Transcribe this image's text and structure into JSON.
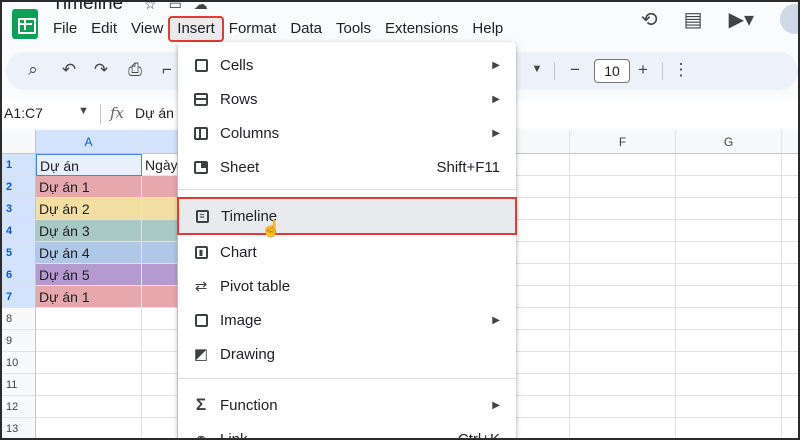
{
  "app": {
    "doc_title": "Timeline",
    "logo_icon": "sheets-logo-icon"
  },
  "menubar": {
    "items": [
      "File",
      "Edit",
      "View",
      "Insert",
      "Format",
      "Data",
      "Tools",
      "Extensions",
      "Help"
    ],
    "active": "Insert"
  },
  "toolbar": {
    "font_size": "10",
    "minus": "−",
    "plus": "+",
    "more": "⋮"
  },
  "formula_bar": {
    "name_box": "A1:C7",
    "fx": "fx",
    "value": "Dự án"
  },
  "grid": {
    "columns": [
      "A",
      "",
      "F",
      "G"
    ],
    "rows": [
      "1",
      "2",
      "3",
      "4",
      "5",
      "6",
      "7",
      "8",
      "9",
      "10",
      "11",
      "12",
      "13"
    ],
    "col_a_values": [
      "Dự án",
      "Dự án 1",
      "Dự án 2",
      "Dự án 3",
      "Dự án 4",
      "Dự án 5",
      "Dự án 1"
    ],
    "col_b_header": "Ngày",
    "row_colors": [
      "#ffffff",
      "#e6a8ad",
      "#f3dfa2",
      "#a9c9c4",
      "#b0c8e8",
      "#b59ad0",
      "#e6a8ad"
    ]
  },
  "insert_menu": {
    "items": [
      {
        "label": "Cells",
        "shortcut": "",
        "submenu": true,
        "icon": "cells-icon"
      },
      {
        "label": "Rows",
        "shortcut": "",
        "submenu": true,
        "icon": "rows-icon"
      },
      {
        "label": "Columns",
        "shortcut": "",
        "submenu": true,
        "icon": "columns-icon"
      },
      {
        "label": "Sheet",
        "shortcut": "Shift+F11",
        "submenu": false,
        "icon": "sheet-icon"
      },
      {
        "label": "Timeline",
        "shortcut": "",
        "submenu": false,
        "icon": "timeline-icon"
      },
      {
        "label": "Chart",
        "shortcut": "",
        "submenu": false,
        "icon": "chart-icon"
      },
      {
        "label": "Pivot table",
        "shortcut": "",
        "submenu": false,
        "icon": "pivot-table-icon"
      },
      {
        "label": "Image",
        "shortcut": "",
        "submenu": true,
        "icon": "image-icon"
      },
      {
        "label": "Drawing",
        "shortcut": "",
        "submenu": false,
        "icon": "drawing-icon"
      },
      {
        "label": "Function",
        "shortcut": "",
        "submenu": true,
        "icon": "function-icon"
      },
      {
        "label": "Link",
        "shortcut": "Ctrl+K",
        "submenu": false,
        "icon": "link-icon"
      }
    ],
    "highlighted": "Timeline"
  },
  "colors": {
    "highlight_outline": "#e53935",
    "selection_blue": "#4285f4"
  }
}
